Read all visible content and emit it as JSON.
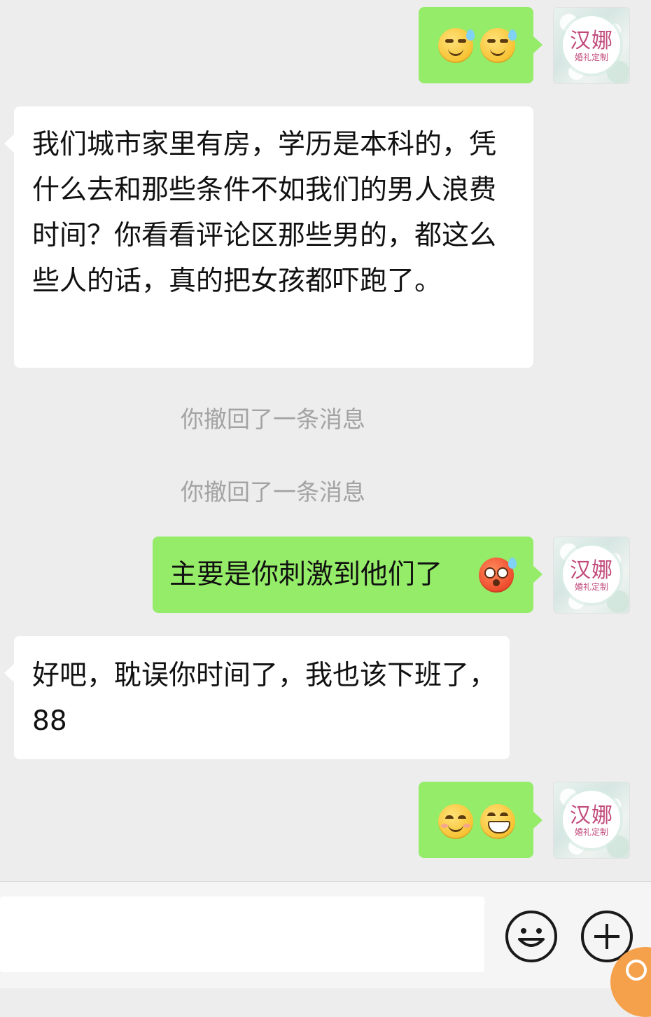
{
  "chat": {
    "avatar_name": "汉娜",
    "avatar_sub": "婚礼定制",
    "messages": [
      {
        "side": "right",
        "type": "emoji",
        "emojis": [
          "sweat-smile-face",
          "sweat-smile-face"
        ]
      },
      {
        "side": "left",
        "type": "text",
        "text": "我们城市家里有房，学历是本科的，凭什么去和那些条件不如我们的男人浪费时间？你看看评论区那些男的，都这么些人的话，真的把女孩都吓跑了。"
      },
      {
        "side": "system",
        "text": "你撤回了一条消息"
      },
      {
        "side": "system",
        "text": "你撤回了一条消息"
      },
      {
        "side": "right",
        "type": "text",
        "text": "主要是你刺激到他们了",
        "emoji": "flushed-face"
      },
      {
        "side": "left",
        "type": "text",
        "text": "好吧，耽误你时间了，我也该下班了，88"
      },
      {
        "side": "right",
        "type": "emoji",
        "emojis": [
          "smile-face",
          "grin-face"
        ]
      }
    ]
  },
  "colors": {
    "background": "#ededed",
    "sent_bubble": "#95ec69",
    "received_bubble": "#ffffff",
    "system_text": "#a3a3a3"
  },
  "input_bar": {
    "emoji_button_icon": "emoji-icon",
    "more_button_icon": "plus-circle-icon"
  }
}
